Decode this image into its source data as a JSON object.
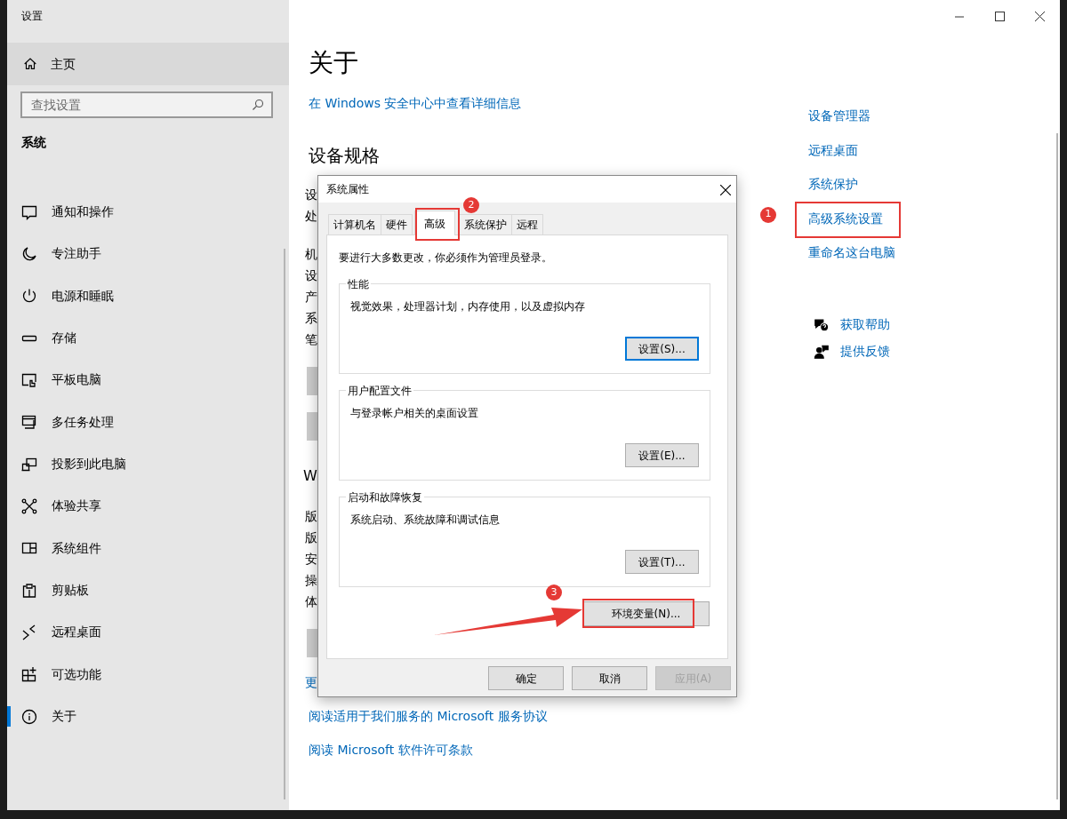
{
  "window": {
    "title": "设置"
  },
  "sidebar": {
    "home": {
      "label": "主页"
    },
    "search": {
      "placeholder": "查找设置"
    },
    "section": "系统",
    "items": [
      {
        "label": "通知和操作",
        "selected": false
      },
      {
        "label": "专注助手",
        "selected": false
      },
      {
        "label": "电源和睡眠",
        "selected": false
      },
      {
        "label": "存储",
        "selected": false
      },
      {
        "label": "平板电脑",
        "selected": false
      },
      {
        "label": "多任务处理",
        "selected": false
      },
      {
        "label": "投影到此电脑",
        "selected": false
      },
      {
        "label": "体验共享",
        "selected": false
      },
      {
        "label": "系统组件",
        "selected": false
      },
      {
        "label": "剪贴板",
        "selected": false
      },
      {
        "label": "远程桌面",
        "selected": false
      },
      {
        "label": "可选功能",
        "selected": false
      },
      {
        "label": "关于",
        "selected": true
      }
    ]
  },
  "main": {
    "title": "关于",
    "security_link": "在 Windows 安全中心中查看详细信息",
    "specs_heading": "设备规格",
    "covered_sections": [
      {
        "kind": "rows",
        "rows": [
          "设",
          "处"
        ]
      },
      {
        "kind": "rows",
        "rows": [
          "机",
          "设",
          "产",
          "系",
          "笔"
        ]
      },
      {
        "kind": "button"
      },
      {
        "kind": "button"
      },
      {
        "kind": "heading",
        "text": "W"
      },
      {
        "kind": "rows",
        "rows": [
          "版",
          "版",
          "安",
          "操",
          "体"
        ]
      },
      {
        "kind": "button"
      },
      {
        "kind": "link",
        "text": "更"
      }
    ],
    "links": [
      "阅读适用于我们服务的 Microsoft 服务协议",
      "阅读 Microsoft 软件许可条款"
    ]
  },
  "related": {
    "links": [
      {
        "label": "设备管理器",
        "highlighted": false
      },
      {
        "label": "远程桌面",
        "highlighted": false
      },
      {
        "label": "系统保护",
        "highlighted": false
      },
      {
        "label": "高级系统设置",
        "highlighted": true,
        "step": "1"
      },
      {
        "label": "重命名这台电脑",
        "highlighted": false
      }
    ],
    "help": [
      {
        "label": "获取帮助"
      },
      {
        "label": "提供反馈"
      }
    ]
  },
  "dialog": {
    "title": "系统属性",
    "tabs": [
      {
        "label": "计算机名",
        "selected": false
      },
      {
        "label": "硬件",
        "selected": false
      },
      {
        "label": "高级",
        "selected": true,
        "highlighted": true,
        "step": "2"
      },
      {
        "label": "系统保护",
        "selected": false
      },
      {
        "label": "远程",
        "selected": false
      }
    ],
    "notice": "要进行大多数更改，你必须作为管理员登录。",
    "groups": [
      {
        "legend": "性能",
        "description": "视觉效果，处理器计划，内存使用，以及虚拟内存",
        "button": {
          "label": "设置(S)...",
          "default": true
        }
      },
      {
        "legend": "用户配置文件",
        "description": "与登录帐户相关的桌面设置",
        "button": {
          "label": "设置(E)...",
          "default": false
        }
      },
      {
        "legend": "启动和故障恢复",
        "description": "系统启动、系统故障和调试信息",
        "button": {
          "label": "设置(T)...",
          "default": false
        }
      }
    ],
    "env_button": {
      "label": "环境变量(N)...",
      "highlighted": true,
      "step": "3",
      "arrow": true
    },
    "buttons": [
      {
        "label": "确定",
        "disabled": false
      },
      {
        "label": "取消",
        "disabled": false
      },
      {
        "label": "应用(A)",
        "disabled": true
      }
    ]
  }
}
